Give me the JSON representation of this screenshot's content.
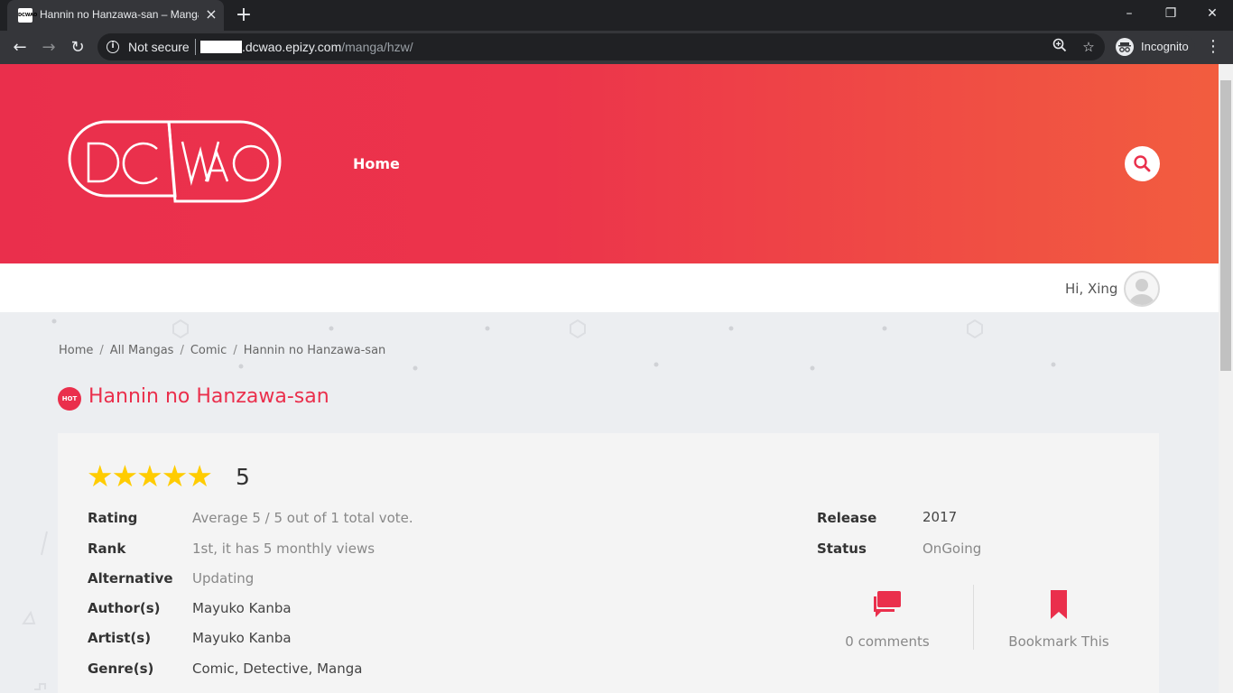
{
  "browser": {
    "tab_title": "Hannin no Hanzawa-san – Manga",
    "favicon_text": "DCWAO",
    "security_label": "Not secure",
    "url_host": ".dcwao.epizy.com",
    "url_path": "/manga/hzw/",
    "profile_label": "Incognito"
  },
  "site": {
    "logo_text": "DCWAO",
    "nav_home": "Home",
    "greeting": "Hi, Xing"
  },
  "breadcrumb": {
    "items": [
      "Home",
      "All Mangas",
      "Comic",
      "Hannin no Hanzawa-san"
    ]
  },
  "manga": {
    "badge": "HOT",
    "title": "Hannin no Hanzawa-san",
    "stars_display": "★★★★★",
    "rating_score": "5",
    "fields": {
      "rating_label": "Rating",
      "rating_value": "Average 5 / 5 out of 1 total vote.",
      "rank_label": "Rank",
      "rank_value": "1st, it has 5 monthly views",
      "alternative_label": "Alternative",
      "alternative_value": "Updating",
      "authors_label": "Author(s)",
      "authors_value": "Mayuko Kanba",
      "artists_label": "Artist(s)",
      "artists_value": "Mayuko Kanba",
      "genres_label": "Genre(s)",
      "genres": [
        "Comic",
        "Detective",
        "Manga"
      ],
      "release_label": "Release",
      "release_value": "2017",
      "status_label": "Status",
      "status_value": "OnGoing"
    },
    "actions": {
      "comments_label": "0 comments",
      "bookmark_label": "Bookmark This"
    }
  },
  "colors": {
    "brand": "#ea2f4c",
    "brand_end": "#f25d3f",
    "star": "#ffcc00"
  },
  "icons": [
    "info-icon",
    "search-icon",
    "zoom-icon",
    "star-icon",
    "incognito-icon",
    "comments-icon",
    "bookmark-icon",
    "avatar-icon"
  ]
}
